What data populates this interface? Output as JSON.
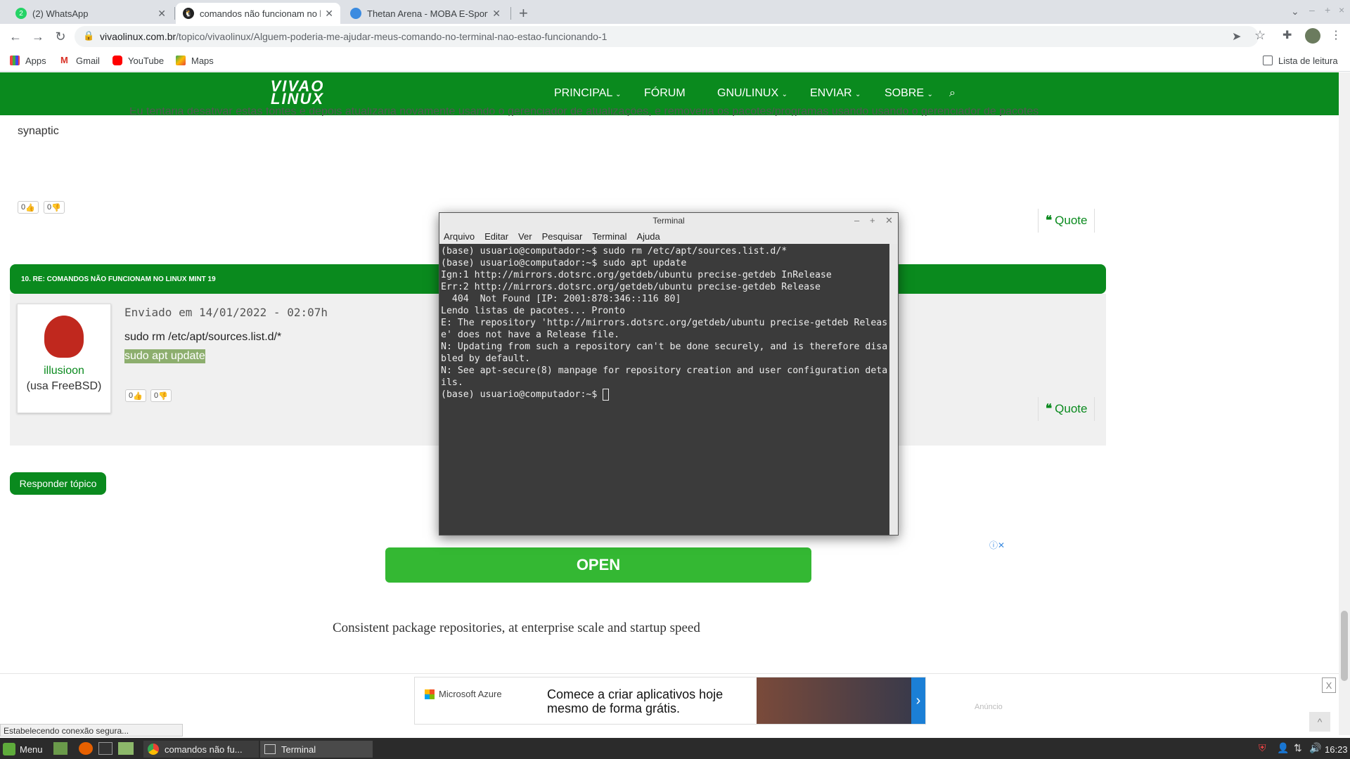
{
  "browser": {
    "tabs": [
      {
        "label": "(2) WhatsApp"
      },
      {
        "label": "comandos não funcionam no l"
      },
      {
        "label": "Thetan Arena - MOBA E-Sport"
      }
    ],
    "new_tab": "+",
    "url_domain": "vivaolinux.com.br",
    "url_path": "/topico/vivaolinux/Alguem-poderia-me-ajudar-meus-comando-no-terminal-nao-estao-funcionando-1",
    "bookmarks": [
      "Apps",
      "Gmail",
      "YouTube",
      "Maps"
    ],
    "reading_list": "Lista de leitura"
  },
  "site": {
    "logo_line1": "VIVAO",
    "logo_line2": "LINUX",
    "menu": [
      "PRINCIPAL",
      "FÓRUM",
      "GNU/LINUX",
      "ENVIAR",
      "SOBRE"
    ],
    "prev_text": "synaptic",
    "prev_partial": "Eu tentaria desativar estas fontes e depois atualizaria novamente usando o gerenciador de atualizações, e removeria os pacotes/programas usando usando o gerenciador de pacotes",
    "vote_up": "0",
    "vote_down": "0",
    "quote": "Quote",
    "post_title": "10. RE: COMANDOS NÃO FUNCIONAM NO LINUX MINT 19",
    "post_date": "Enviado em 14/01/2022 - 02:07h",
    "post_line1": "sudo rm /etc/apt/sources.list.d/*",
    "post_line2": "sudo apt update",
    "user_name": "illusioon",
    "user_os": "(usa FreeBSD)",
    "reply_button": "Responder tópico",
    "ad_open": "OPEN",
    "ad_text": "Consistent package repositories, at enterprise scale and startup speed",
    "azure_brand": "Microsoft Azure",
    "azure_line1": "Comece a criar aplicativos hoje",
    "azure_line2": "mesmo de forma grátis.",
    "ad_label": "Anúncio",
    "ad_close": "X"
  },
  "terminal": {
    "title": "Terminal",
    "menu": [
      "Arquivo",
      "Editar",
      "Ver",
      "Pesquisar",
      "Terminal",
      "Ajuda"
    ],
    "output": "(base) usuario@computador:~$ sudo rm /etc/apt/sources.list.d/*\n(base) usuario@computador:~$ sudo apt update\nIgn:1 http://mirrors.dotsrc.org/getdeb/ubuntu precise-getdeb InRelease\nErr:2 http://mirrors.dotsrc.org/getdeb/ubuntu precise-getdeb Release\n  404  Not Found [IP: 2001:878:346::116 80]\nLendo listas de pacotes... Pronto\nE: The repository 'http://mirrors.dotsrc.org/getdeb/ubuntu precise-getdeb Release' does not have a Release file.\nN: Updating from such a repository can't be done securely, and is therefore disabled by default.\nN: See apt-secure(8) manpage for repository creation and user configuration details.\n",
    "prompt": "(base) usuario@computador:~$ "
  },
  "status_text": "Estabelecendo conexão segura...",
  "taskbar": {
    "menu": "Menu",
    "items": [
      "comandos não fu...",
      "Terminal"
    ],
    "clock": "16:23"
  },
  "colors": {
    "brand_green": "#0a8a1e",
    "open_green": "#34b833"
  }
}
